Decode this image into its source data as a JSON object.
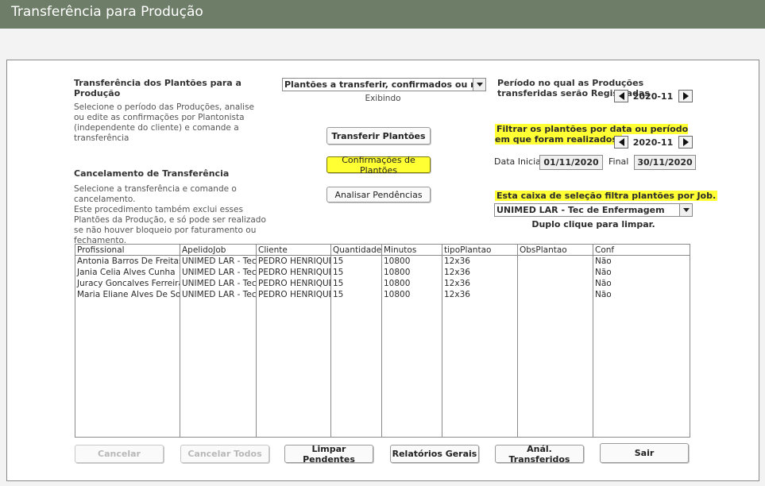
{
  "window": {
    "title": "Transferência para Produção"
  },
  "left": {
    "section1_title": "Transferência dos Plantões para a Produção",
    "section1_desc": "Selecione o período das Produções, analise ou edite as confirmações por Plantonista (independente do cliente)  e comande a transferência",
    "section2_title": "Cancelamento de Transferência",
    "section2_desc": "Selecione a transferência e comande o cancelamento.\nEste procedimento também exclui esses Plantões da Produção, e só pode ser realizado se não houver bloqueio por faturamento ou fechamento."
  },
  "middle": {
    "filter_select_value": "Plantões a transferir, confirmados ou não.",
    "filter_caption": "Exibindo",
    "btn_transferir": "Transferir Plantões",
    "btn_confirmacoes": "Confirmações de Plantões",
    "btn_analisar": "Analisar Pendências"
  },
  "right": {
    "periodo_label": "Período no qual as Produções transferidas serão Registradas",
    "periodo_value": "2020-11",
    "filtrar_label": "Filtrar os plantões por data ou período em que foram realizados:",
    "filtrar_value": "2020-11",
    "data_inicial_label": "Data Inicial",
    "data_inicial_value": "01/11/2020",
    "final_label": "Final",
    "final_value": "30/11/2020",
    "job_label": "Esta caixa de seleção filtra plantões por Job.",
    "job_value": "UNIMED LAR - Tec de Enfermagem",
    "job_hint": "Duplo clique para limpar."
  },
  "table": {
    "columns": [
      "Profissional",
      "ApelidoJob",
      "Cliente",
      "Quantidade",
      "Minutos",
      "tipoPlantao",
      "ObsPlantao",
      "Conf"
    ],
    "rows": [
      [
        "Antonia Barros De Freitas",
        "UNIMED LAR - Tec",
        "PEDRO HENRIQUE",
        "15",
        "10800",
        "12x36",
        "",
        "Não"
      ],
      [
        "Jania Celia Alves Cunha",
        "UNIMED LAR - Tec",
        "PEDRO HENRIQUE",
        "15",
        "10800",
        "12x36",
        "",
        "Não"
      ],
      [
        "Juracy Goncalves Ferreira",
        "UNIMED LAR - Tec",
        "PEDRO HENRIQUE",
        "15",
        "10800",
        "12x36",
        "",
        "Não"
      ],
      [
        "Maria Eliane Alves De Sous",
        "UNIMED LAR - Tec",
        "PEDRO HENRIQUE",
        "15",
        "10800",
        "12x36",
        "",
        "Não"
      ]
    ]
  },
  "footer": {
    "cancelar": "Cancelar",
    "cancelar_todos": "Cancelar Todos",
    "limpar_pendentes": "Limpar Pendentes",
    "relatorios_gerais": "Relatórios Gerais",
    "anal_transferidos": "Anál. Transferidos",
    "sair": "Sair"
  },
  "colors": {
    "titlebar": "#6e7d68",
    "highlight": "#ffff33"
  },
  "icons": [
    "chevron-down-icon",
    "arrow-left-icon",
    "arrow-right-icon"
  ]
}
